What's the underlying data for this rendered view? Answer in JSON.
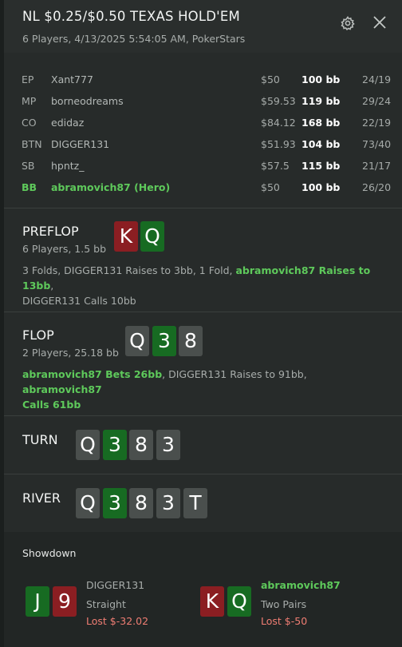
{
  "header": {
    "title": "NL $0.25/$0.50 TEXAS HOLD'EM",
    "subtitle": "6 Players, 4/13/2025 5:54:05 AM, PokerStars",
    "settings_icon": "gear-icon",
    "close_icon": "close-icon"
  },
  "players": [
    {
      "pos": "EP",
      "name": "Xant777",
      "stack": "$50",
      "bb": "100 bb",
      "stats": "24/19",
      "hero": false
    },
    {
      "pos": "MP",
      "name": "borneodreams",
      "stack": "$59.53",
      "bb": "119 bb",
      "stats": "29/24",
      "hero": false
    },
    {
      "pos": "CO",
      "name": "edidaz",
      "stack": "$84.12",
      "bb": "168 bb",
      "stats": "22/19",
      "hero": false
    },
    {
      "pos": "BTN",
      "name": "DIGGER131",
      "stack": "$51.93",
      "bb": "104 bb",
      "stats": "73/40",
      "hero": false
    },
    {
      "pos": "SB",
      "name": "hpntz_",
      "stack": "$57.5",
      "bb": "115 bb",
      "stats": "21/17",
      "hero": false
    },
    {
      "pos": "BB",
      "name": "abramovich87 (Hero)",
      "stack": "$50",
      "bb": "100 bb",
      "stats": "26/20",
      "hero": true
    }
  ],
  "preflop": {
    "title": "PREFLOP",
    "sub": "6 Players, 1.5 bb",
    "cards": [
      {
        "rank": "K",
        "color": "red"
      },
      {
        "rank": "Q",
        "color": "green"
      }
    ],
    "actions": {
      "a1": "3 Folds, DIGGER131 Raises to 3bb, 1 Fold, ",
      "a2": "abramovich87 Raises to 13bb",
      "a3": ",",
      "a4": "DIGGER131 Calls 10bb"
    }
  },
  "flop": {
    "title": "FLOP",
    "sub": "2 Players, 25.18 bb",
    "cards": [
      {
        "rank": "Q",
        "color": "gray"
      },
      {
        "rank": "3",
        "color": "green"
      },
      {
        "rank": "8",
        "color": "gray"
      }
    ],
    "actions": {
      "a1": "abramovich87 Bets 26bb",
      "a2": ", DIGGER131 Raises to 91bb, ",
      "a3": "abramovich87",
      "a4": "Calls 61bb"
    }
  },
  "turn": {
    "title": "TURN",
    "cards": [
      {
        "rank": "Q",
        "color": "gray"
      },
      {
        "rank": "3",
        "color": "green"
      },
      {
        "rank": "8",
        "color": "gray"
      },
      {
        "rank": "3",
        "color": "gray"
      }
    ]
  },
  "river": {
    "title": "RIVER",
    "cards": [
      {
        "rank": "Q",
        "color": "gray"
      },
      {
        "rank": "3",
        "color": "green"
      },
      {
        "rank": "8",
        "color": "gray"
      },
      {
        "rank": "3",
        "color": "gray"
      },
      {
        "rank": "T",
        "color": "gray"
      }
    ]
  },
  "showdown": {
    "title": "Showdown",
    "left": {
      "cards": [
        {
          "rank": "J",
          "color": "green"
        },
        {
          "rank": "9",
          "color": "red"
        }
      ],
      "name": "DIGGER131",
      "hand": "Straight",
      "result": "Lost $-32.02"
    },
    "right": {
      "cards": [
        {
          "rank": "K",
          "color": "red"
        },
        {
          "rank": "Q",
          "color": "green"
        }
      ],
      "name": "abramovich87",
      "hand": "Two Pairs",
      "result": "Lost $-50"
    }
  },
  "colors": {
    "hero_green": "#5ec95b",
    "card_red": "#8b1e22",
    "card_green": "#176b22",
    "card_gray": "#4a4f4d",
    "loss_red": "#ef7d73"
  }
}
